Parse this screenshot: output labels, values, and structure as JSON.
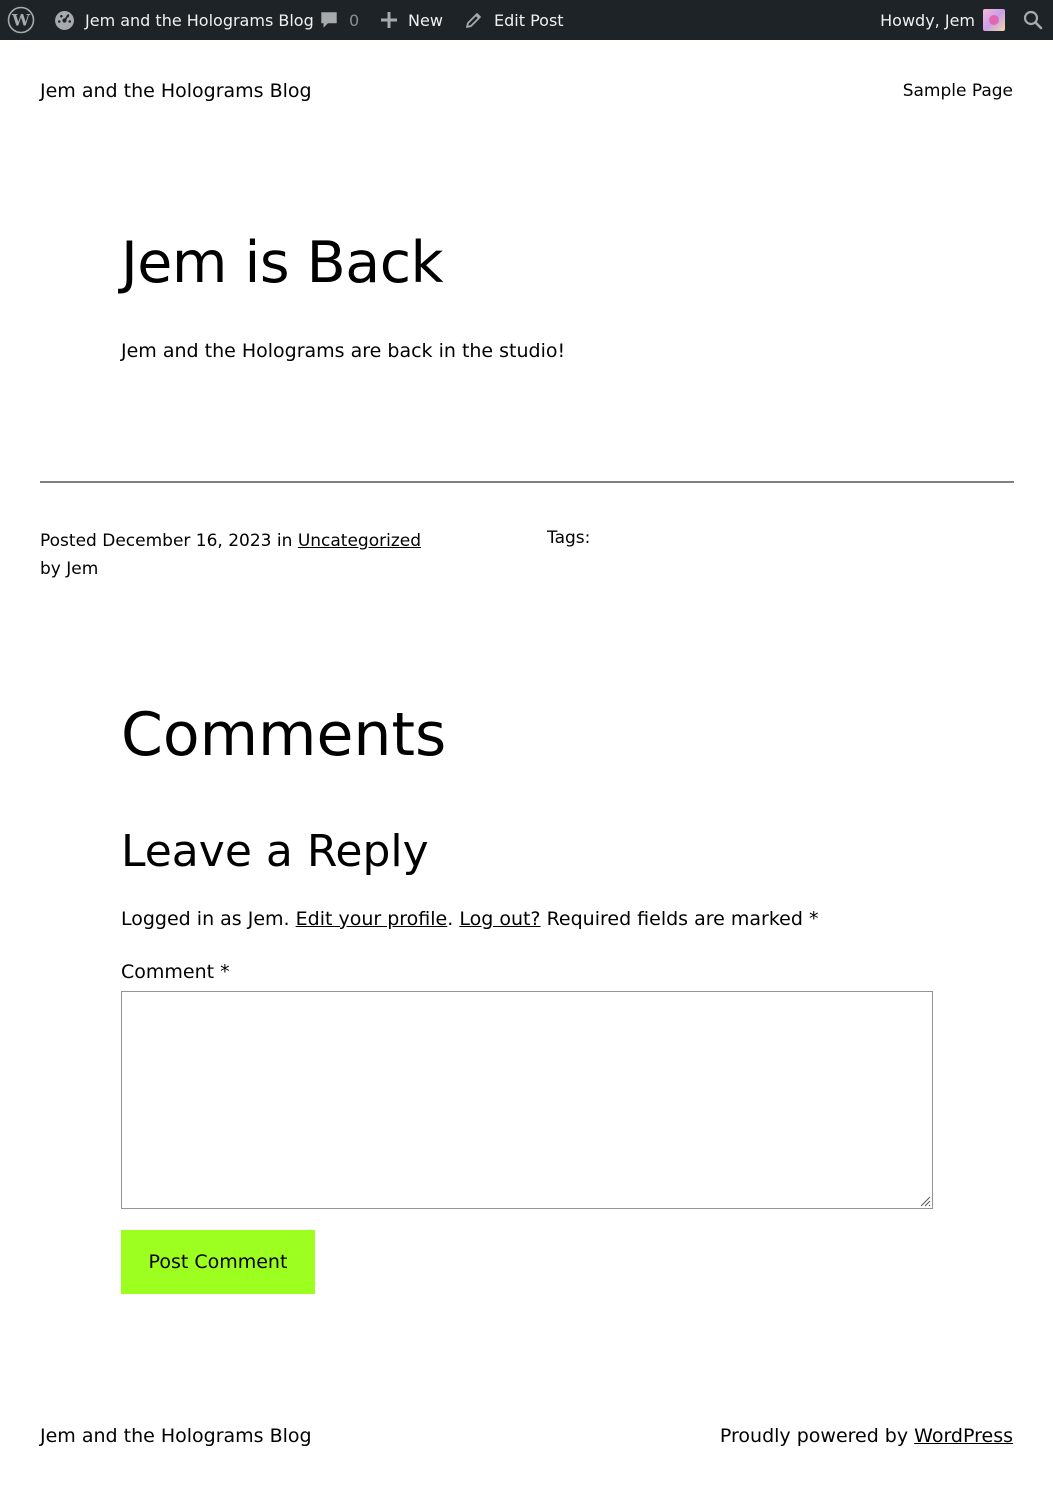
{
  "adminbar": {
    "site_name": "Jem and the Holograms Blog",
    "comments_count": "0",
    "new_label": "New",
    "edit_label": "Edit Post",
    "howdy": "Howdy, Jem"
  },
  "header": {
    "site_title": "Jem and the Holograms Blog",
    "nav_sample": "Sample Page"
  },
  "post": {
    "title": "Jem is Back",
    "body": "Jem and the Holograms are back in the studio!",
    "posted_prefix": "Posted",
    "date": "December 16, 2023",
    "in_word": "in",
    "category": "Uncategorized",
    "by_prefix": "by",
    "author": "Jem",
    "tags_label": "Tags:"
  },
  "comments": {
    "heading": "Comments",
    "reply_heading": "Leave a Reply",
    "logged_in_text": "Logged in as Jem.",
    "edit_profile": "Edit your profile",
    "period": ".",
    "logout": "Log out?",
    "required_text": "Required fields are marked",
    "required_mark": "*",
    "comment_label": "Comment *",
    "submit_label": "Post Comment"
  },
  "footer": {
    "title": "Jem and the Holograms Blog",
    "powered_prefix": "Proudly powered by ",
    "powered_link": "WordPress"
  },
  "colors": {
    "adminbar_bg": "#1d2327",
    "button_bg": "#9dff20",
    "divider": "#808080"
  }
}
